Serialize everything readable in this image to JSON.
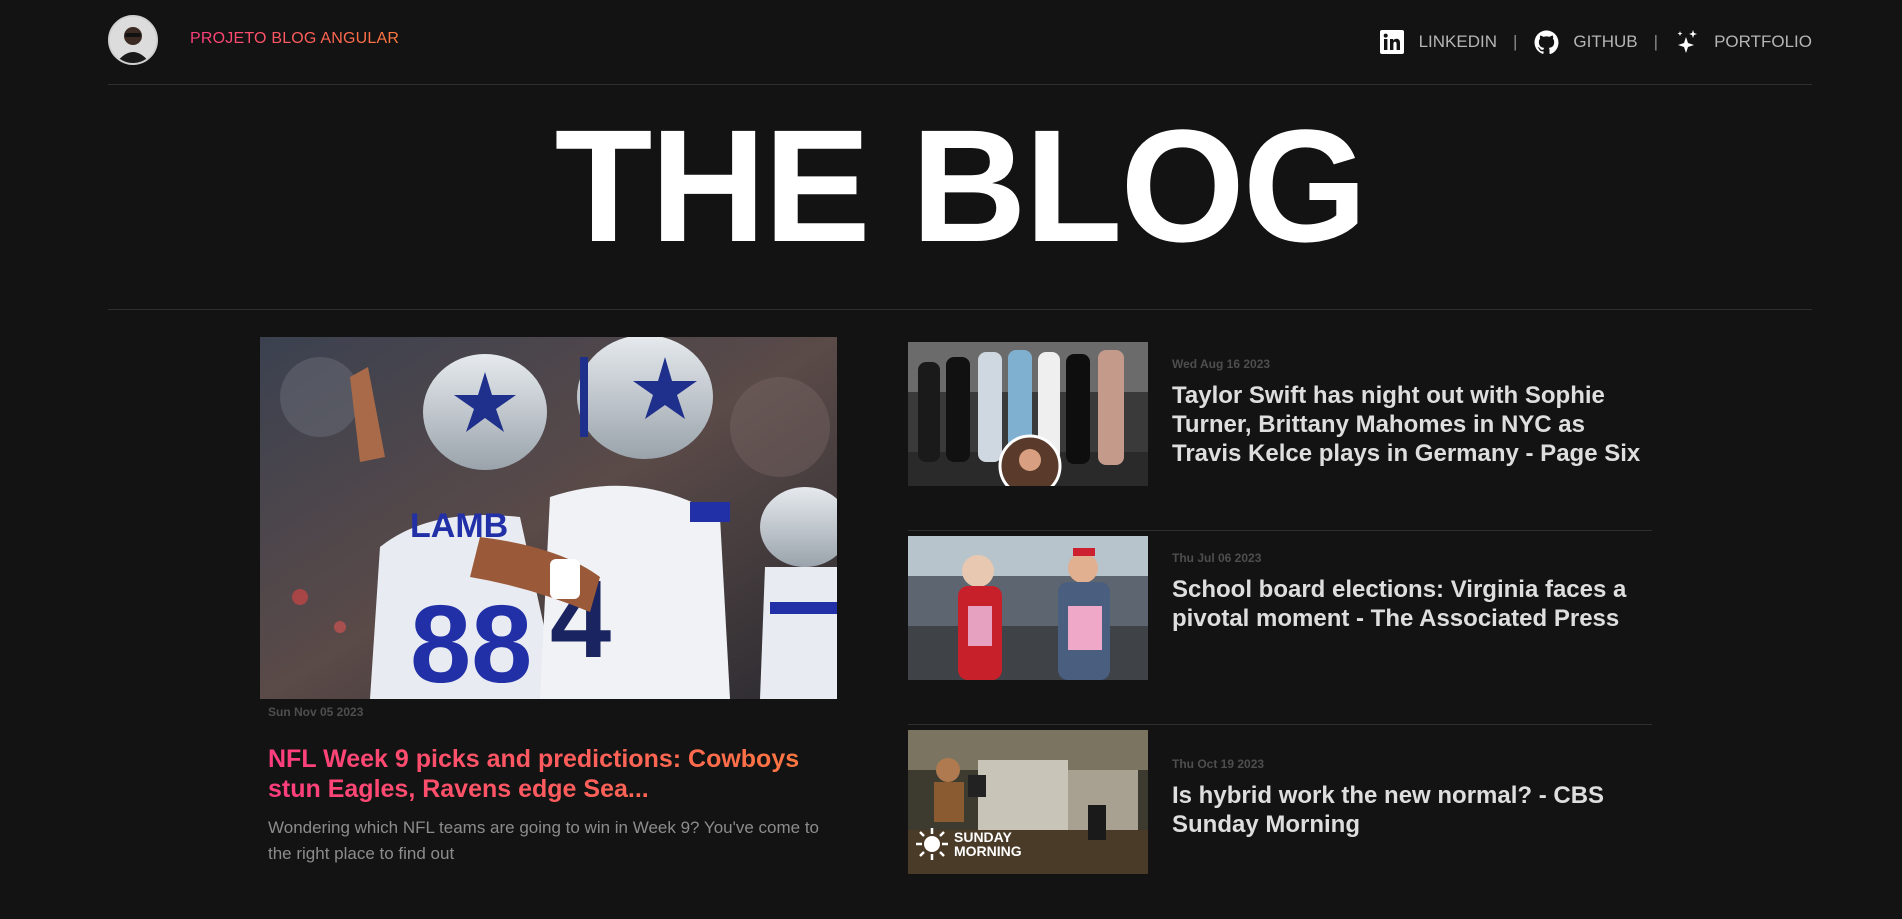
{
  "header": {
    "brand": "PROJETO BLOG ANGULAR",
    "nav": [
      {
        "label": "LINKEDIN",
        "icon": "linkedin-icon"
      },
      {
        "label": "GITHUB",
        "icon": "github-icon"
      },
      {
        "label": "PORTFOLIO",
        "icon": "sparkles-icon"
      }
    ],
    "separator": "|"
  },
  "hero": {
    "title": "THE BLOG"
  },
  "featured": {
    "date": "Sun Nov 05 2023",
    "title": "NFL Week 9 picks and predictions: Cowboys stun Eagles, Ravens edge Sea...",
    "description": "Wondering which NFL teams are going to win in Week 9? You've come to the right place to find out"
  },
  "side_posts": [
    {
      "date": "Wed Aug 16 2023",
      "title": "Taylor Swift has night out with Sophie Turner, Brittany Mahomes in NYC as Travis Kelce plays in Germany - Page Six"
    },
    {
      "date": "Thu Jul 06 2023",
      "title": "School board elections: Virginia faces a pivotal moment - The Associated Press"
    },
    {
      "date": "Thu Oct 19 2023",
      "title": "Is hybrid work the new normal? - CBS Sunday Morning",
      "image_caption": "SUNDAY MORNING"
    }
  ],
  "colors": {
    "background": "#131313",
    "accent_start": "#ff3d7f",
    "accent_end": "#ff7a3d",
    "muted": "#8c8c8c",
    "divider": "#2e2e2e"
  }
}
